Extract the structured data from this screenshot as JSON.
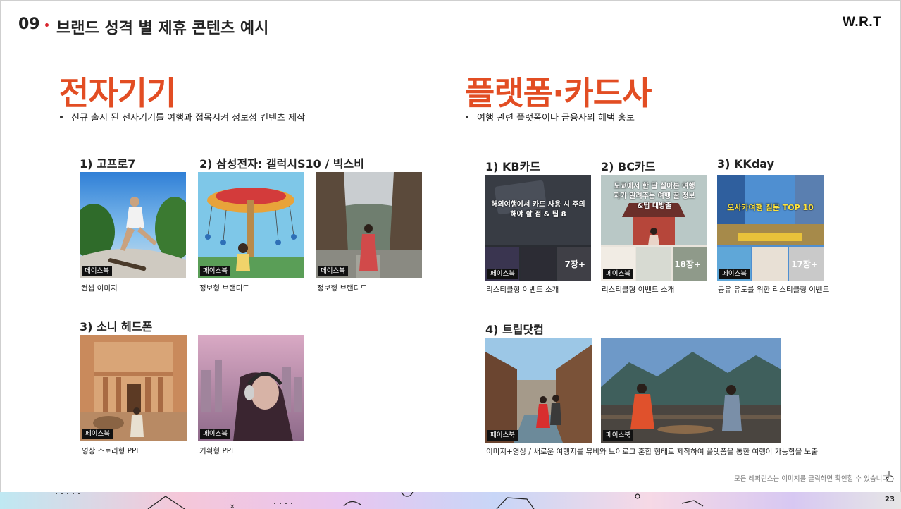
{
  "header": {
    "number": "09",
    "title": "브랜드 성격 별 제휴 콘텐츠 예시",
    "logo": "W.R.T"
  },
  "left": {
    "title": "전자기기",
    "bullet": "신규 출시 된 전자기기를 여행과 접목시켜 정보성 컨텐츠 제작",
    "sections": [
      {
        "label": "1) 고프로7"
      },
      {
        "label": "2) 삼성전자: 갤럭시S10 / 빅스비"
      },
      {
        "label": "3) 소니 헤드폰"
      }
    ],
    "items": [
      {
        "tag": "페이스북",
        "caption": "컨셉 이미지"
      },
      {
        "tag": "페이스북",
        "caption": "정보형 브랜디드"
      },
      {
        "tag": "페이스북",
        "caption": "정보형 브랜디드"
      },
      {
        "tag": "페이스북",
        "caption": "영상 스토리형 PPL"
      },
      {
        "tag": "페이스북",
        "caption": "기획형 PPL"
      }
    ]
  },
  "right": {
    "title": "플랫폼·카드사",
    "bullet": "여행 관련 플랫폼이나 금융사의 혜택 홍보",
    "sections": [
      {
        "label": "1) KB카드"
      },
      {
        "label": "2) BC카드"
      },
      {
        "label": "3) KKday"
      },
      {
        "label": "4) 트립닷컴"
      }
    ],
    "items": [
      {
        "tag": "페이스북",
        "caption": "리스티클형 이벤트 소개",
        "count": "7장+",
        "overlay": "해외여행에서 카드 사용 시 주의해야 할 점 & 팁 8"
      },
      {
        "tag": "페이스북",
        "caption": "리스티클형 이벤트 소개",
        "count": "18장+",
        "overlay": "도쿄에서 한 달 살아본 여행자가 알려주는 여행 꿀 정보&팁 대방출"
      },
      {
        "tag": "페이스북",
        "caption": "공유 유도를 위한 리스티클형 이벤트",
        "count": "17장+",
        "overlay": "오사카여행 질문 TOP 10"
      },
      {
        "tag": "페이스북"
      },
      {
        "tag": "페이스북"
      }
    ],
    "trip_caption": "이미지+영상 / 새로운 여행지를 뮤비와 브이로그 혼합 형태로 제작하여 플랫폼을 통한 여행이 가능함을 노출"
  },
  "footer": {
    "note": "모든 레퍼런스는 이미지를 클릭하면 확인할 수 있습니다",
    "page": "23"
  }
}
